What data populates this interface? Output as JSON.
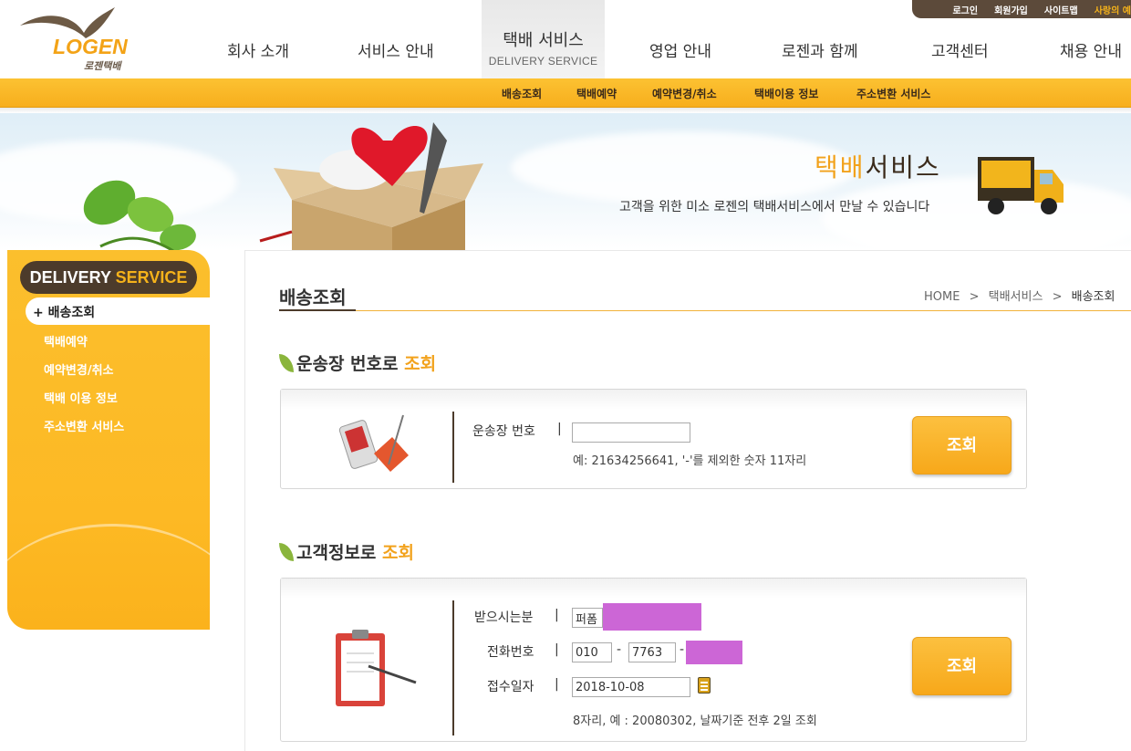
{
  "header": {
    "logo_text": "LOGEN",
    "logo_sub": "로젠택배",
    "util_links": [
      "로그인",
      "회원가입",
      "사이트맵",
      "사랑의 예"
    ],
    "nav": [
      {
        "label": "회사 소개"
      },
      {
        "label": "서비스 안내"
      },
      {
        "label": "택배 서비스",
        "sub": "DELIVERY SERVICE"
      },
      {
        "label": "영업 안내"
      },
      {
        "label": "로젠과 함께"
      },
      {
        "label": "고객센터"
      },
      {
        "label": "채용 안내"
      }
    ],
    "subnav": [
      "배송조회",
      "택배예약",
      "예약변경/취소",
      "택배이용 정보",
      "주소변환 서비스"
    ]
  },
  "banner": {
    "title_orange": "택배",
    "title_rest": "서비스",
    "subtitle": "고객을 위한 미소 로젠의 택배서비스에서 만날 수 있습니다"
  },
  "sidebar": {
    "title_a": "DELIVERY",
    "title_b": "SERVICE",
    "active_item": "+ 배송조회",
    "items": [
      "택배예약",
      "예약변경/취소",
      "택배 이용 정보",
      "주소변환 서비스"
    ]
  },
  "page": {
    "title": "배송조회",
    "breadcrumb": {
      "home": "HOME",
      "sep": ">",
      "level1": "택배서비스",
      "current": "배송조회"
    }
  },
  "waybill_section": {
    "title_a": "운송장 번호로",
    "title_b": "조회",
    "label": "운송장 번호",
    "bar": "|",
    "input_value": "",
    "hint": "예: 21634256641, '-'를 제외한 숫자 11자리",
    "button": "조회"
  },
  "customer_section": {
    "title_a": "고객정보로",
    "title_b": "조회",
    "recipient_label": "받으시는분",
    "recipient_value": "퍼폼",
    "phone_label": "전화번호",
    "phone_1": "010",
    "phone_2": "7763",
    "phone_3": "",
    "dash": "-",
    "date_label": "접수일자",
    "date_value": "2018-10-08",
    "date_hint": "8자리, 예 : 20080302, 날짜기준 전후 2일 조회",
    "bar": "|",
    "button": "조회"
  },
  "colors": {
    "accent": "#F7AE1D",
    "brand_brown": "#4C3B2B",
    "redact": "#CC66D6"
  }
}
